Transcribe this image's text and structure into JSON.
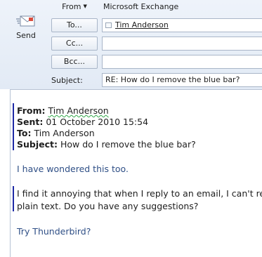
{
  "toolbar": {
    "send_label": "Send"
  },
  "header": {
    "from_button": "From",
    "from_value": "Microsoft Exchange",
    "to_button": "To...",
    "to_recipient": "Tim Anderson",
    "cc_button": "Cc...",
    "bcc_button": "Bcc...",
    "subject_label": "Subject:",
    "subject_value": "RE: How do I remove the blue bar?"
  },
  "message": {
    "from_label": "From:",
    "from_value": "Tim Anderson",
    "sent_label": "Sent:",
    "sent_value": "01 October 2010 15:54",
    "to_label": "To:",
    "to_value": "Tim Anderson",
    "subject_label": "Subject:",
    "subject_value": "How do I remove the blue bar?",
    "reply_line": "I have wondered this too.",
    "quoted_line1": "I find it annoying that when I reply to an email, I can't rem",
    "quoted_line2": "plain text. Do you have any suggestions?",
    "closing_line": "Try Thunderbird?"
  },
  "colors": {
    "quote_bar": "#1f2aa6",
    "reply_text": "#2f4f86",
    "header_bg": "#e8eef7"
  }
}
